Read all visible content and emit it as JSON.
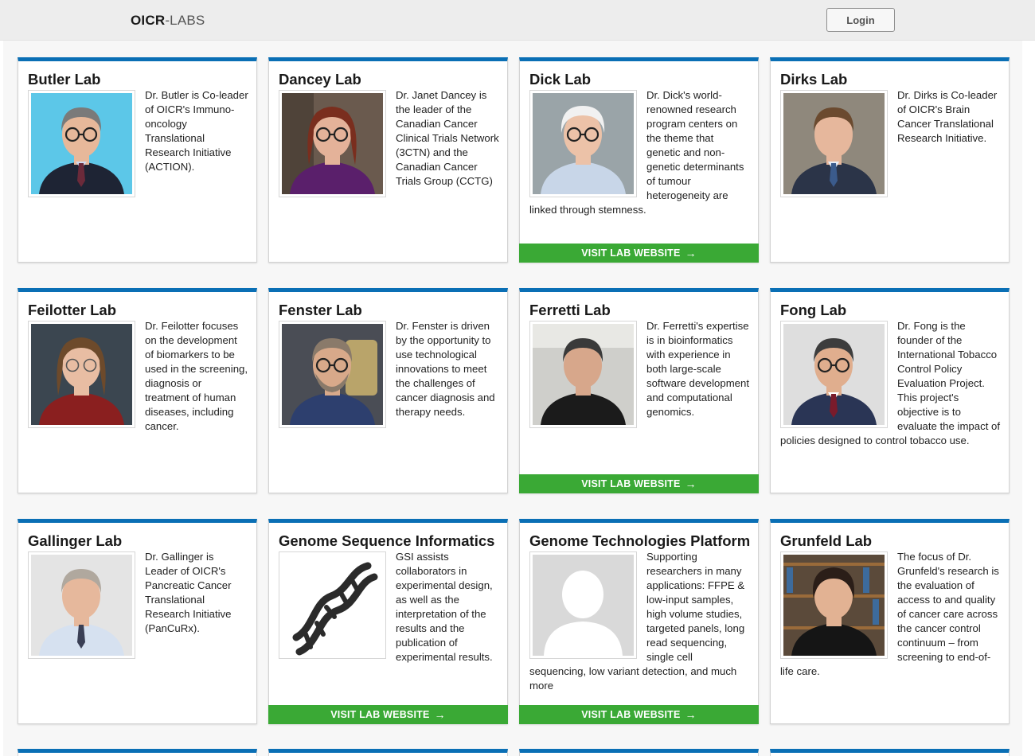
{
  "header": {
    "brand_bold": "OICR",
    "brand_rest": "-LABS",
    "login_label": "Login"
  },
  "labs": [
    {
      "title": "Butler Lab",
      "description": "Dr. Butler is Co-leader of OICR's Immuno-oncology Translational Research Initiative (ACTION).",
      "photo": "portrait-man-glasses-blue-background",
      "has_visit_link": false
    },
    {
      "title": "Dancey Lab",
      "description": "Dr. Janet Dancey is the leader of the Canadian Cancer Clinical Trials Network (3CTN) and the Canadian Cancer Trials Group (CCTG)",
      "photo": "portrait-woman-glasses",
      "has_visit_link": false
    },
    {
      "title": "Dick Lab",
      "description": "Dr. Dick's world-renowned research program centers on the theme that genetic and non-genetic determinants of tumour heterogeneity are linked through stemness.",
      "photo": "portrait-man-white-hair",
      "has_visit_link": true
    },
    {
      "title": "Dirks Lab",
      "description": "Dr. Dirks is Co-leader of OICR's Brain Cancer Translational Research Initiative.",
      "photo": "portrait-man-suit",
      "has_visit_link": false
    },
    {
      "title": "Feilotter Lab",
      "description": "Dr. Feilotter focuses on the development of biomarkers to be used in the screening, diagnosis or treatment of human diseases, including cancer.",
      "photo": "portrait-woman-lab",
      "has_visit_link": false
    },
    {
      "title": "Fenster Lab",
      "description": "Dr. Fenster is driven by the opportunity to use technological innovations to meet the challenges of cancer diagnosis and therapy needs.",
      "photo": "portrait-man-beard-equipment",
      "has_visit_link": false
    },
    {
      "title": "Ferretti Lab",
      "description": "Dr. Ferretti's expertise is in bioinformatics with experience in both large-scale software development and computational genomics.",
      "photo": "portrait-man-dark-shirt-office",
      "has_visit_link": true
    },
    {
      "title": "Fong Lab",
      "description": "Dr. Fong is the founder of the International Tobacco Control Policy Evaluation Project. This project's objective is to evaluate the impact of policies designed to control tobacco use.",
      "photo": "portrait-man-glasses-grey-background",
      "has_visit_link": false
    },
    {
      "title": "Gallinger Lab",
      "description": "Dr. Gallinger is Leader of OICR's Pancreatic Cancer Translational Research Initiative (PanCuRx).",
      "photo": "portrait-man-shirt-tie",
      "has_visit_link": false
    },
    {
      "title": "Genome Sequence Informatics",
      "description": "GSI assists collaborators in experimental design, as well as the interpretation of the results and the publication of experimental results.",
      "photo": "dna-helix-icon",
      "has_visit_link": true
    },
    {
      "title": "Genome Technologies Platform",
      "description": "Supporting researchers in many applications: FFPE & low-input samples, high volume studies, targeted panels, long read sequencing, single cell sequencing, low variant detection, and much more",
      "photo": "placeholder-person-icon",
      "has_visit_link": true
    },
    {
      "title": "Grunfeld Lab",
      "description": "The focus of Dr. Grunfeld's research is the evaluation of access to and quality of cancer care across the cancer control continuum – from screening to end-of-life care.",
      "photo": "portrait-woman-bookshelf",
      "has_visit_link": false
    }
  ],
  "visit_label": "VISIT LAB WEBSITE",
  "visit_arrow": "→",
  "colors": {
    "accent_blue": "#0a6fb5",
    "visit_green": "#3aa935",
    "topbar_bg": "#ededed",
    "page_bg": "#f7f7f7"
  }
}
